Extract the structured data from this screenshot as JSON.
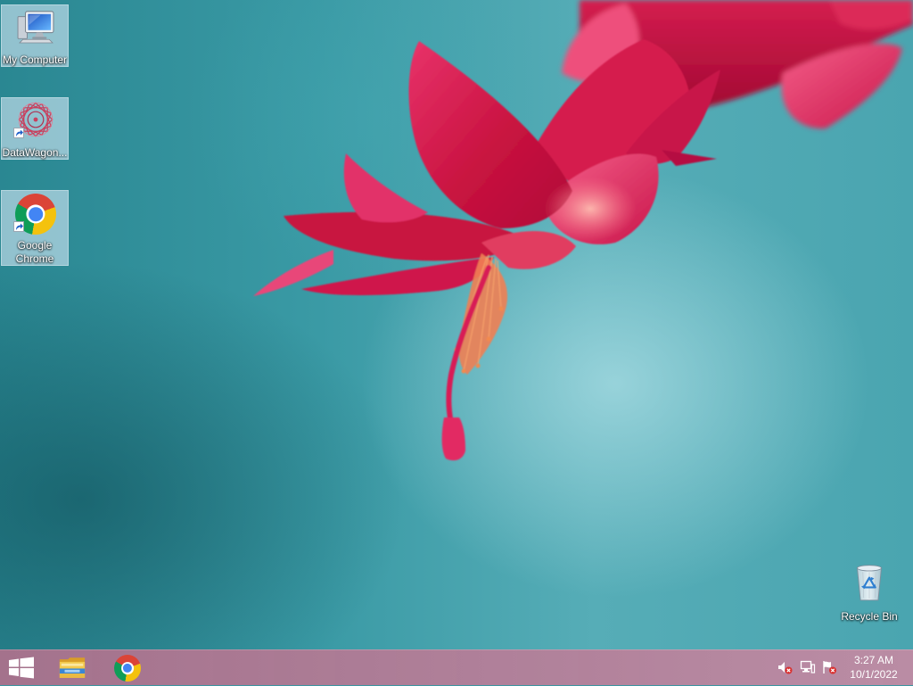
{
  "desktop": {
    "icons": [
      {
        "label": "My Computer",
        "icon": "computer-icon",
        "shortcut": false,
        "selected": true
      },
      {
        "label": "DataWagon...",
        "icon": "datawagon-icon",
        "shortcut": true,
        "selected": true
      },
      {
        "label": "Google Chrome",
        "icon": "chrome-icon",
        "shortcut": true,
        "selected": true
      }
    ],
    "recycle_bin": {
      "label": "Recycle Bin",
      "icon": "recycle-bin-icon"
    }
  },
  "taskbar": {
    "start_button": {
      "icon": "windows-logo-icon"
    },
    "pinned_apps": [
      {
        "icon": "file-explorer-icon"
      },
      {
        "icon": "chrome-icon"
      }
    ],
    "tray_icons": [
      "volume-muted-icon",
      "network-icon",
      "action-center-flag-icon"
    ],
    "clock": {
      "time": "3:27 AM",
      "date": "10/1/2022"
    }
  },
  "colors": {
    "taskbar": "#b07b97",
    "wallpaper": "#56adb7",
    "flower": "#c8123f",
    "selection": "#dcecfa"
  }
}
